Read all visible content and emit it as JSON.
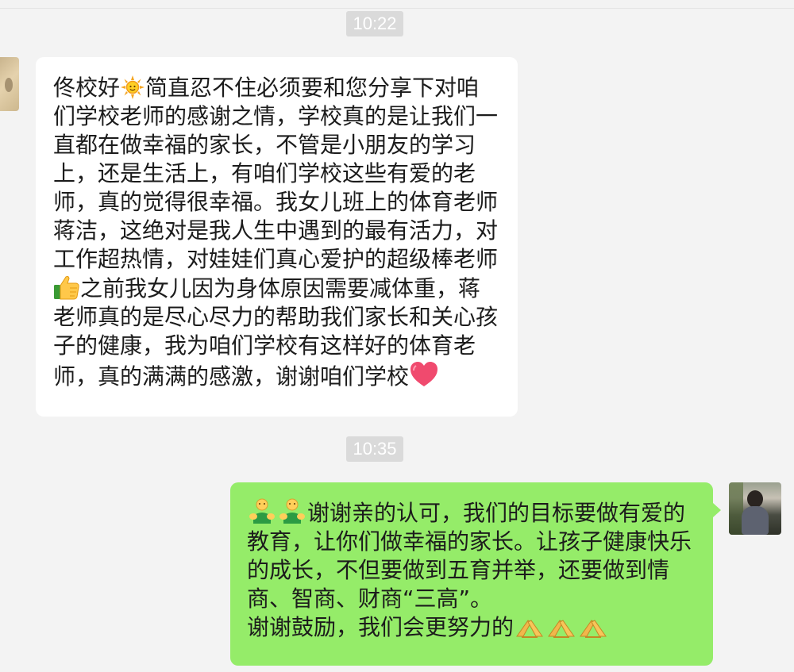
{
  "timestamps": {
    "first": "10:22",
    "second": "10:35"
  },
  "messages": {
    "received": {
      "part1": "佟校好",
      "part2": "简直忍不住必须要和您分享下对咱们学校老师的感谢之情，学校真的是让我们一直都在做幸福的家长，不管是小朋友的学习上，还是生活上，有咱们学校这些有爱的老师，真的觉得很幸福。我女儿班上的体育老师蒋洁，这绝对是我人生中遇到的最有活力，对工作超热情，对娃娃们真心爱护的超级棒老师",
      "part3": "之前我女儿因为身体原因需要减体重，蒋老师真的是尽心尽力的帮助我们家长和关心孩子的健康，我为咱们学校有这样好的体育老师，真的满满的感激，谢谢咱们学校",
      "emojis": [
        "sun-emoji",
        "thumbs-up-emoji",
        "heart-emoji"
      ]
    },
    "sent": {
      "line1": "谢谢亲的认可，我们的目标要做有爱的教育，让你们做幸福的家长。让孩子健康快乐的成长，不但要做到五育并举，还要做到情商、智商、财商“三高”。",
      "line2": "谢谢鼓励，我们会更努力的",
      "emojis": [
        "hug-emoji",
        "hug-emoji",
        "pray-emoji",
        "pray-emoji",
        "pray-emoji"
      ]
    }
  },
  "colors": {
    "background": "#f3f3f3",
    "received_bubble": "#ffffff",
    "sent_bubble": "#95ec69",
    "timestamp_bg": "#dadada",
    "timestamp_text": "#ffffff",
    "text": "#1c1c1c"
  }
}
